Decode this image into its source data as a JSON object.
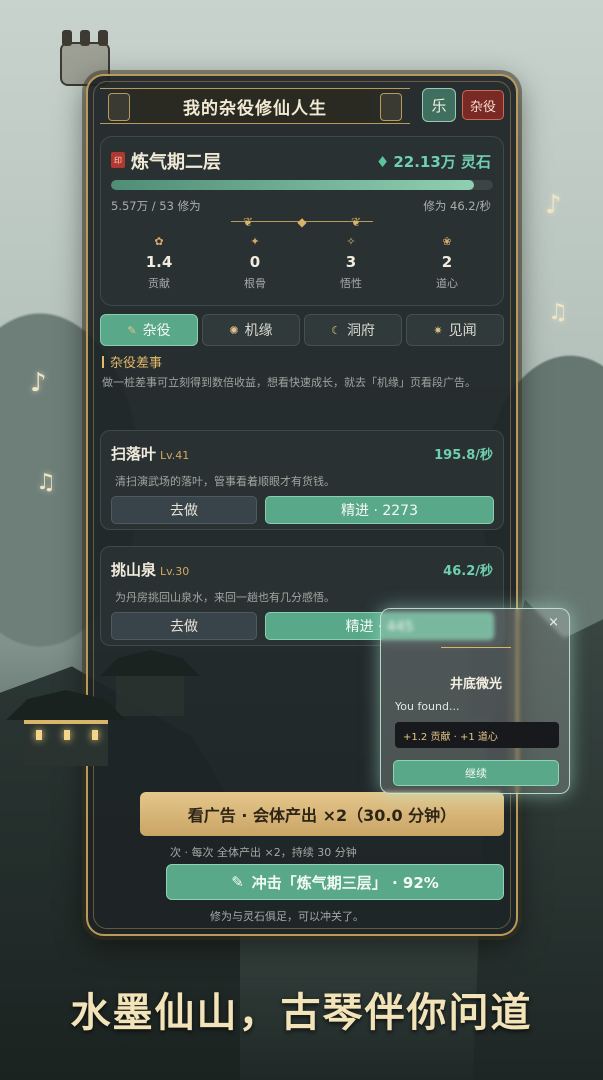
{
  "header": {
    "title": "我的杂役修仙人生",
    "music_label": "乐",
    "chore_label": "杂役"
  },
  "realm": {
    "name": "炼气期二层",
    "seal": "印",
    "spirit_stone": "22.13万 灵石",
    "progress": 0.95,
    "cultivation_count": "5.57万 / 53 修为",
    "cultivation_rate": "修为 46.2/秒",
    "stats": [
      {
        "icon": "contribution-icon",
        "glyph": "✿",
        "value": "1.4",
        "label": "贡献"
      },
      {
        "icon": "root-icon",
        "glyph": "✦",
        "value": "0",
        "label": "根骨"
      },
      {
        "icon": "insight-icon",
        "glyph": "✧",
        "value": "3",
        "label": "悟性"
      },
      {
        "icon": "heart-icon",
        "glyph": "❀",
        "value": "2",
        "label": "道心"
      }
    ]
  },
  "tabs": [
    {
      "label": "杂役",
      "icon": "broom-icon",
      "glyph": "✎",
      "active": true
    },
    {
      "label": "机缘",
      "icon": "fortune-icon",
      "glyph": "✺",
      "active": false
    },
    {
      "label": "洞府",
      "icon": "cave-icon",
      "glyph": "☾",
      "active": false
    },
    {
      "label": "见闻",
      "icon": "news-icon",
      "glyph": "✷",
      "active": false
    }
  ],
  "section": {
    "title": "杂役差事",
    "desc": "做一桩差事可立刻得到数倍收益，想看快速成长，就去「机缘」页看段广告。"
  },
  "tasks": [
    {
      "name": "扫落叶",
      "level": "Lv.41",
      "rate": "195.8/秒",
      "desc": "清扫演武场的落叶，管事看着顺眼才有货钱。",
      "do_label": "去做",
      "advance_label": "精进 · 2273"
    },
    {
      "name": "挑山泉",
      "level": "Lv.30",
      "rate": "46.2/秒",
      "desc": "为丹房挑回山泉水，来回一趟也有几分感悟。",
      "do_label": "去做",
      "advance_label": "精进 · 445"
    }
  ],
  "ad": {
    "label": "看广告 · 会体产出 ×2（30.0 分钟）",
    "note": "次 · 每次 全体产出 ×2，持续 30 分钟"
  },
  "breakthrough": {
    "label": "冲击「炼气期三层」 · 92%",
    "note": "修为与灵石俱足，可以冲关了。"
  },
  "popup": {
    "title": "井底微光",
    "text": "You found...",
    "reward": "+1.2 贡献 · +1 道心",
    "button": "继续",
    "close": "×"
  },
  "tagline": "水墨仙山，古琴伴你问道",
  "colors": {
    "accent_green": "#5aa88a",
    "gold": "#b89a5c",
    "stone_green": "#6fd0ae",
    "panel": "#1e2426"
  }
}
